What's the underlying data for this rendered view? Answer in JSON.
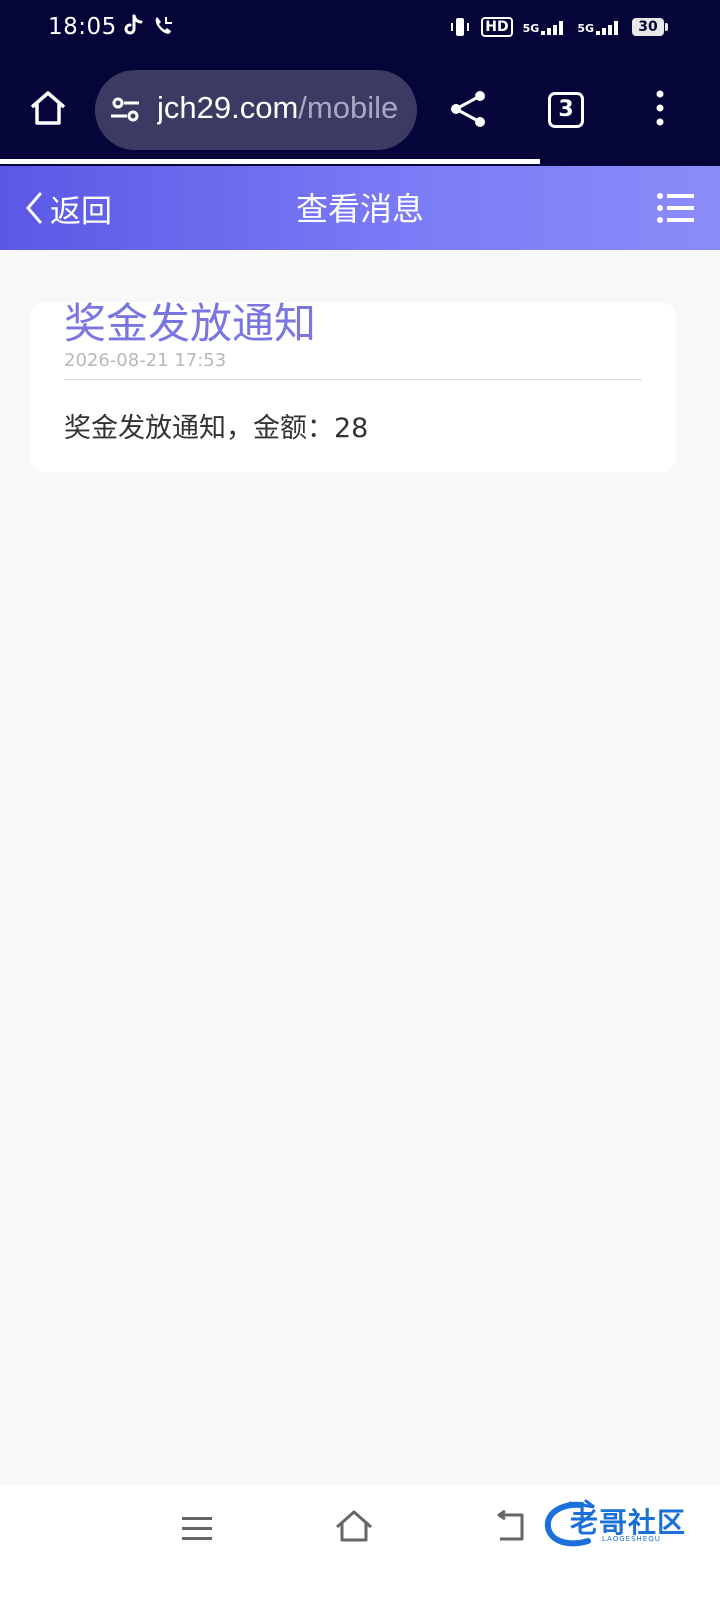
{
  "status_bar": {
    "time": "18:05",
    "left_icons": [
      "tiktok-icon",
      "call-icon"
    ],
    "right_icons": [
      "vibrate-icon",
      "hd-icon",
      "signal-5g-icon",
      "signal-5g-icon"
    ],
    "hd_label": "HD",
    "net1": "5G",
    "net2": "5G",
    "battery": "30"
  },
  "browser": {
    "url_host": "jch29.com",
    "url_path": "/mobile",
    "tab_count": "3",
    "page_load_progress": 0.75
  },
  "header": {
    "back_label": "返回",
    "title": "查看消息"
  },
  "message": {
    "title": "奖金发放通知",
    "datetime": "2026-08-21 17:53",
    "body": "奖金发放通知，金额：28"
  },
  "nav_bar": {
    "watermark_text": "老哥社区",
    "watermark_sub": "LAOGESHEQU"
  },
  "colors": {
    "system_bar": "#05053a",
    "header_gradient_start": "#5b58e5",
    "header_gradient_end": "#8b8bf8",
    "title_accent": "#7a76e0"
  }
}
